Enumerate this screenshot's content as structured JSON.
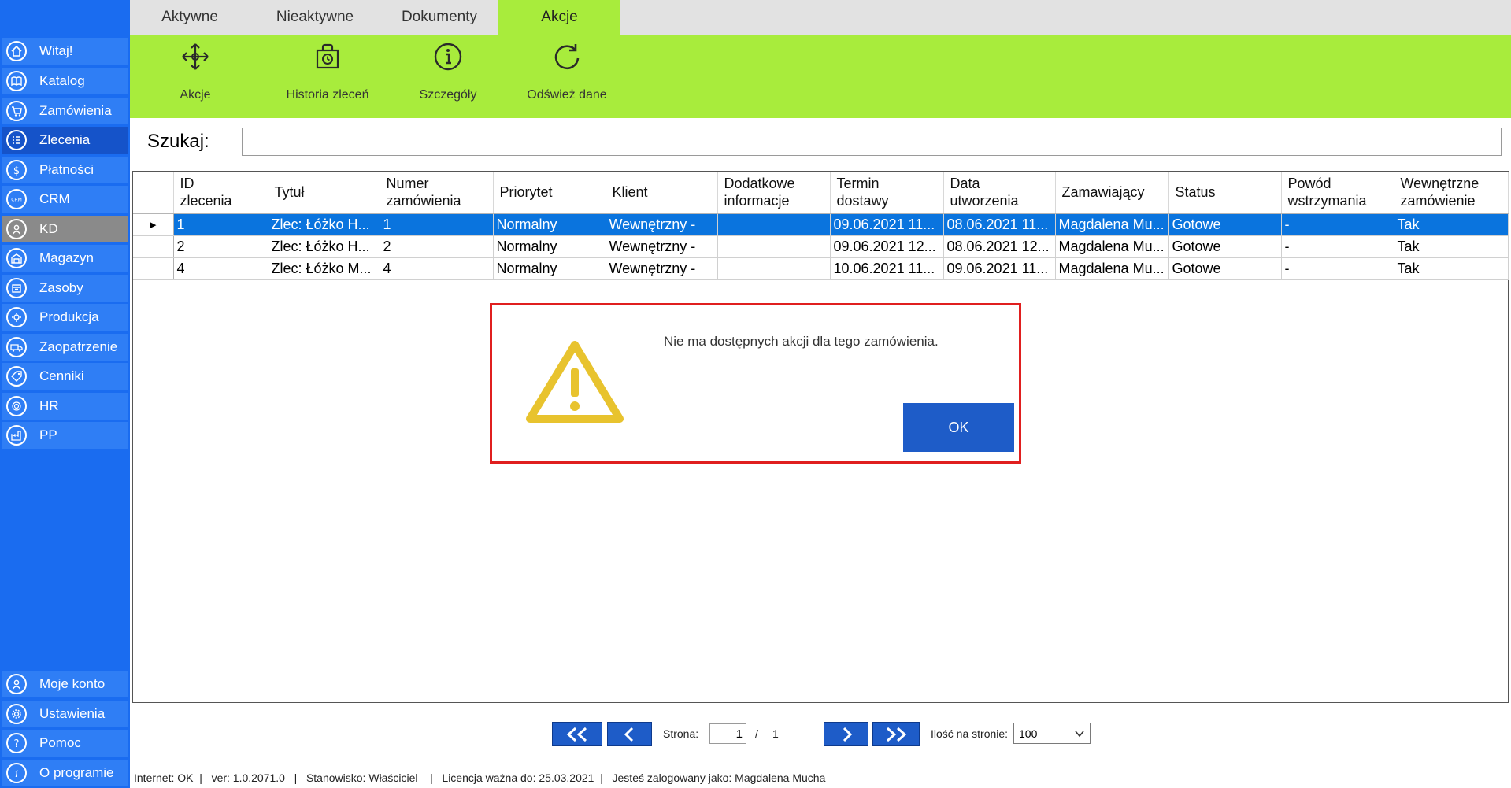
{
  "sidebar": {
    "items": [
      {
        "label": "Witaj!",
        "icon": "home-icon"
      },
      {
        "label": "Katalog",
        "icon": "book-icon"
      },
      {
        "label": "Zamówienia",
        "icon": "cart-icon"
      },
      {
        "label": "Zlecenia",
        "icon": "list-icon"
      },
      {
        "label": "Płatności",
        "icon": "dollar-icon"
      },
      {
        "label": "CRM",
        "icon": "crm-icon"
      },
      {
        "label": "KD",
        "icon": "user-icon"
      },
      {
        "label": "Magazyn",
        "icon": "warehouse-icon"
      },
      {
        "label": "Zasoby",
        "icon": "box-icon"
      },
      {
        "label": "Produkcja",
        "icon": "production-icon"
      },
      {
        "label": "Zaopatrzenie",
        "icon": "truck-icon"
      },
      {
        "label": "Cenniki",
        "icon": "tag-icon"
      },
      {
        "label": "HR",
        "icon": "fingerprint-icon"
      },
      {
        "label": "PP",
        "icon": "factory-icon"
      }
    ],
    "bottom_items": [
      {
        "label": "Moje konto",
        "icon": "account-icon"
      },
      {
        "label": "Ustawienia",
        "icon": "gear-icon"
      },
      {
        "label": "Pomoc",
        "icon": "help-icon"
      },
      {
        "label": "O programie",
        "icon": "info-icon"
      }
    ]
  },
  "tabs": [
    "Aktywne",
    "Nieaktywne",
    "Dokumenty",
    "Akcje"
  ],
  "ribbon": [
    "Akcje",
    "Historia zleceń",
    "Szczegóły",
    "Odśwież dane"
  ],
  "search": {
    "label": "Szukaj:",
    "value": ""
  },
  "table": {
    "headers": [
      [
        "ID",
        "zlecenia"
      ],
      [
        "Tytuł",
        ""
      ],
      [
        "Numer",
        "zamówienia"
      ],
      [
        "Priorytet",
        ""
      ],
      [
        "Klient",
        ""
      ],
      [
        "Dodatkowe",
        "informacje"
      ],
      [
        "Termin",
        "dostawy"
      ],
      [
        "Data",
        "utworzenia"
      ],
      [
        "Zamawiający",
        ""
      ],
      [
        "Status",
        ""
      ],
      [
        "Powód",
        "wstrzymania"
      ],
      [
        "Wewnętrzne",
        "zamówienie"
      ]
    ],
    "rows": [
      [
        "1",
        "Zlec: Łóżko H...",
        "1",
        "Normalny",
        "Wewnętrzny -",
        "",
        "09.06.2021 11...",
        "08.06.2021 11...",
        "Magdalena Mu...",
        "Gotowe",
        "-",
        "Tak"
      ],
      [
        "2",
        "Zlec: Łóżko H...",
        "2",
        "Normalny",
        "Wewnętrzny -",
        "",
        "09.06.2021 12...",
        "08.06.2021 12...",
        "Magdalena Mu...",
        "Gotowe",
        "-",
        "Tak"
      ],
      [
        "4",
        "Zlec: Łóżko M...",
        "4",
        "Normalny",
        "Wewnętrzny -",
        "",
        "10.06.2021 11...",
        "09.06.2021 11...",
        "Magdalena Mu...",
        "Gotowe",
        "-",
        "Tak"
      ]
    ]
  },
  "dialog": {
    "message": "Nie ma dostępnych akcji dla tego zamówienia.",
    "ok_label": "OK"
  },
  "pager": {
    "page_label": "Strona:",
    "page_value": "1",
    "separator": "/",
    "total_pages": "1",
    "per_page_label": "Ilość na stronie:",
    "per_page_value": "100"
  },
  "statusbar": {
    "text": "Internet: OK  |   ver: 1.0.2071.0   |   Stanowisko: Właściciel    |   Licencja ważna do: 25.03.2021  |   Jesteś zalogowany jako: Magdalena Mucha"
  },
  "colors": {
    "sidebar": "#1a6cf0",
    "ribbon": "#a8ec3c",
    "selection": "#0a74de",
    "dialog_border": "#e01f1f",
    "ok_button": "#1e5cc8",
    "warning": "#e8c32e"
  }
}
